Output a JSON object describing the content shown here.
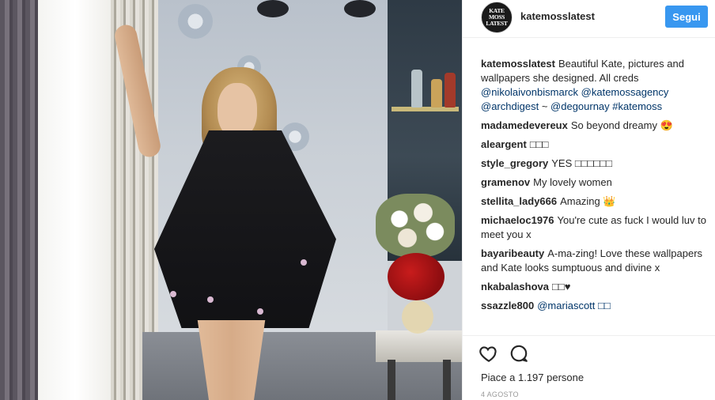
{
  "header": {
    "avatar_text_line1": "KATE MOSS",
    "avatar_text_line2": "LATEST",
    "username": "katemosslatest",
    "follow_label": "Segui"
  },
  "caption": {
    "user": "katemosslatest",
    "text": "Beautiful Kate, pictures and wallpapers she designed. All creds",
    "mentions": [
      "@nikolaivonbismarck",
      "@katemossagency",
      "@archdigest",
      "~",
      "@degournay",
      "#katemoss"
    ]
  },
  "comments": [
    {
      "user": "madamedevereux",
      "text": "So beyond dreamy 😍"
    },
    {
      "user": "aleargent",
      "text": "□□□"
    },
    {
      "user": "style_gregory",
      "text": "YES □□□□□□"
    },
    {
      "user": "gramenov",
      "text": "My lovely women"
    },
    {
      "user": "stellita_lady666",
      "text": "Amazing 👑"
    },
    {
      "user": "michaeloc1976",
      "text": "You're cute as fuck I would luv to meet you x"
    },
    {
      "user": "bayaribeauty",
      "text": "A-ma-zing! Love these wallpapers and Kate looks sumptuous and divine x"
    },
    {
      "user": "nkabalashova",
      "text": "□□♥"
    },
    {
      "user": "ssazzle800",
      "text": "@mariascott □□"
    }
  ],
  "actions": {
    "like_icon": "heart-icon",
    "comment_icon": "comment-bubble-icon"
  },
  "likes_text": "Piace a 1.197 persone",
  "date": "4 AGOSTO",
  "colors": {
    "follow_button": "#3897f0",
    "mention": "#003569",
    "text": "#262626",
    "muted": "#999999"
  }
}
